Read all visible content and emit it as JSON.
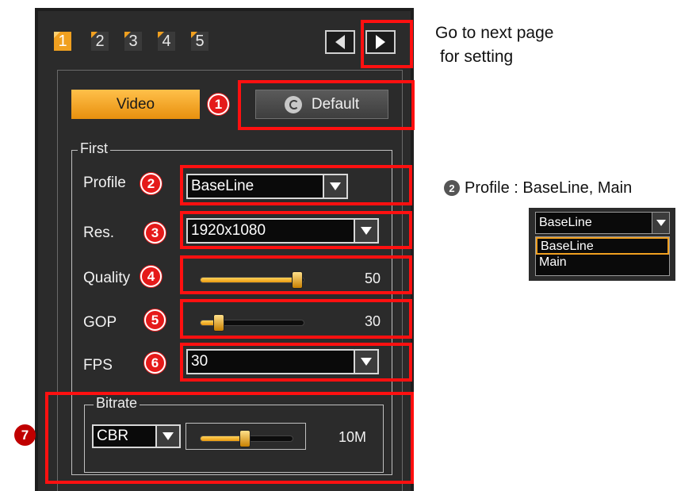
{
  "tabs": [
    {
      "label": "1",
      "active": true
    },
    {
      "label": "2",
      "active": false
    },
    {
      "label": "3",
      "active": false
    },
    {
      "label": "4",
      "active": false
    },
    {
      "label": "5",
      "active": false
    }
  ],
  "buttons": {
    "video": "Video",
    "default": "Default"
  },
  "first_group": {
    "title": "First",
    "profile": {
      "label": "Profile",
      "value": "BaseLine"
    },
    "resolution": {
      "label": "Res.",
      "value": "1920x1080"
    },
    "quality": {
      "label": "Quality",
      "value": "50",
      "level": 0.95
    },
    "gop": {
      "label": "GOP",
      "value": "30",
      "level": 0.2
    },
    "fps": {
      "label": "FPS",
      "value": "30"
    }
  },
  "bitrate_group": {
    "title": "Bitrate",
    "mode": "CBR",
    "value": "10M",
    "level": 0.5
  },
  "markers": [
    "1",
    "2",
    "3",
    "4",
    "5",
    "6",
    "7"
  ],
  "annotations": {
    "next_page_line1": "Go to next page",
    "next_page_line2": "for setting",
    "profile_note_number": "2",
    "profile_note": "Profile : BaseLine, Main"
  },
  "profile_dropdown": {
    "selected": "BaseLine",
    "options": [
      "BaseLine",
      "Main"
    ]
  },
  "colors": {
    "accent": "#f0a020",
    "highlight": "#ff1010",
    "panel": "#2b2b2b"
  }
}
